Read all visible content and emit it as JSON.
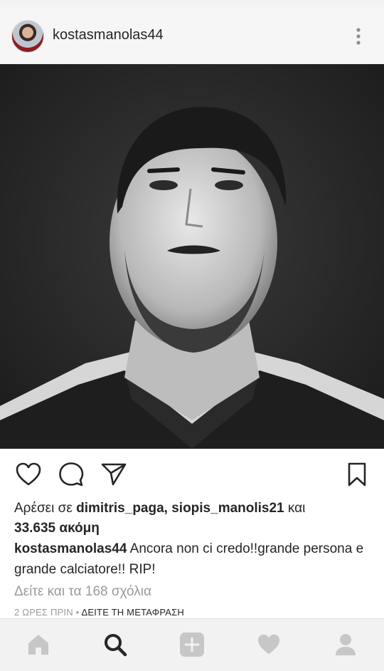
{
  "post": {
    "username": "kostasmanolas44",
    "likes": {
      "prefix": "Αρέσει σε ",
      "users": "dimitris_paga, siopis_manolis21",
      "conj": " και",
      "count": "33.635 ακόμη"
    },
    "caption": {
      "username": "kostasmanolas44",
      "text": " Ancora non ci credo!!grande persona e grande calciatore!! RIP!"
    },
    "view_comments": "Δείτε και τα 168 σχόλια",
    "time": "2 ΩΡΕΣ ΠΡΙΝ",
    "separator": " • ",
    "translate": "ΔΕΙΤΕ ΤΗ ΜΕΤΑΦΡΑΣΗ"
  },
  "icons": {
    "more": "more-vertical-icon",
    "like": "heart-outline-icon",
    "comment": "comment-icon",
    "share": "paper-plane-icon",
    "save": "bookmark-icon"
  },
  "nav": {
    "items": [
      "home-icon",
      "search-icon",
      "add-icon",
      "heart-icon",
      "profile-icon"
    ],
    "active": "search-icon"
  },
  "colors": {
    "text": "#262626",
    "muted": "#9a9a9a",
    "nav_inactive": "#c7c7c7",
    "nav_active": "#262626"
  }
}
